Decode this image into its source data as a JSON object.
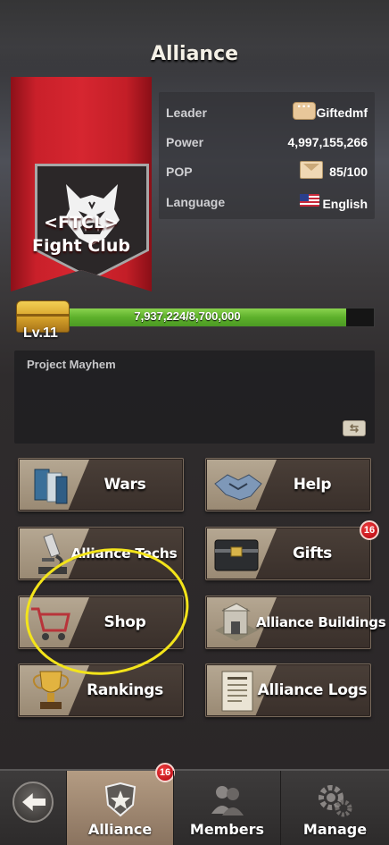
{
  "header": {
    "title": "Alliance"
  },
  "alliance": {
    "tag": "<FTCL>",
    "name": "Fight Club",
    "leader_label": "Leader",
    "leader_value": "Giftedmf",
    "power_label": "Power",
    "power_value": "4,997,155,266",
    "pop_label": "POP",
    "pop_value": "85/100",
    "language_label": "Language",
    "language_value": "English",
    "level": "Lv.11",
    "xp_text": "7,937,224/8,700,000",
    "xp_progress": 0.9123,
    "description": "Project Mayhem"
  },
  "menu": {
    "wars": "Wars",
    "help": "Help",
    "techs": "Alliance Techs",
    "gifts": "Gifts",
    "gifts_badge": "16",
    "shop": "Shop",
    "buildings": "Alliance Buildings",
    "rankings": "Rankings",
    "logs": "Alliance Logs"
  },
  "tabs": {
    "alliance": "Alliance",
    "alliance_badge": "16",
    "members": "Members",
    "manage": "Manage"
  },
  "colors": {
    "banner_red": "#d62630",
    "xp_green": "#5db02b",
    "highlight_yellow": "#f3e41a",
    "badge_red": "#c4141c"
  },
  "icons": {
    "emblem": "wolf-emblem-icon",
    "back": "back-arrow-icon"
  }
}
